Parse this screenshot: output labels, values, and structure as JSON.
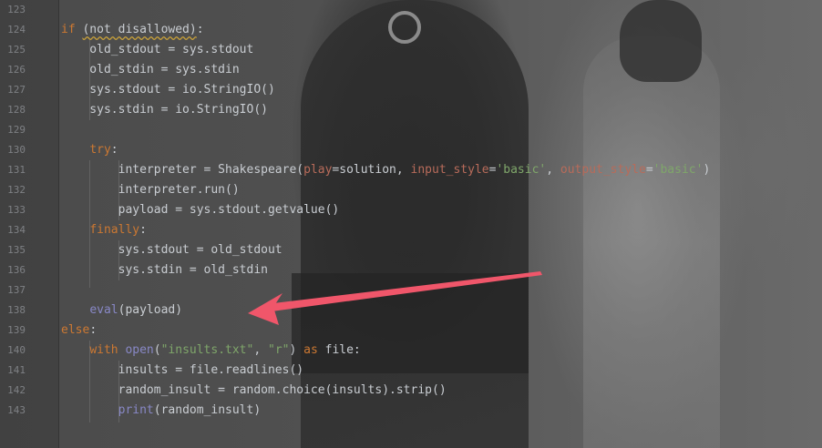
{
  "editor": {
    "lines": [
      {
        "number": "123",
        "tokens": []
      },
      {
        "number": "124",
        "tokens": [
          {
            "t": "if",
            "c": "kw"
          },
          {
            "t": " ",
            "c": "plain"
          },
          {
            "t": "(not disallowed)",
            "c": "plain",
            "squiggle": true
          },
          {
            "t": ":",
            "c": "plain"
          }
        ]
      },
      {
        "number": "125",
        "tokens": [
          {
            "t": "    old_stdout = sys.stdout",
            "c": "plain"
          }
        ]
      },
      {
        "number": "126",
        "tokens": [
          {
            "t": "    old_stdin = sys.stdin",
            "c": "plain"
          }
        ]
      },
      {
        "number": "127",
        "tokens": [
          {
            "t": "    sys.stdout = io.StringIO()",
            "c": "plain"
          }
        ]
      },
      {
        "number": "128",
        "tokens": [
          {
            "t": "    sys.stdin = io.StringIO()",
            "c": "plain"
          }
        ]
      },
      {
        "number": "129",
        "tokens": []
      },
      {
        "number": "130",
        "tokens": [
          {
            "t": "    ",
            "c": "plain"
          },
          {
            "t": "try",
            "c": "kw"
          },
          {
            "t": ":",
            "c": "plain"
          }
        ]
      },
      {
        "number": "131",
        "tokens": [
          {
            "t": "        interpreter = Shakespeare(",
            "c": "plain"
          },
          {
            "t": "play",
            "c": "param"
          },
          {
            "t": "=solution, ",
            "c": "plain"
          },
          {
            "t": "input_style",
            "c": "param"
          },
          {
            "t": "=",
            "c": "plain"
          },
          {
            "t": "'basic'",
            "c": "str"
          },
          {
            "t": ", ",
            "c": "plain"
          },
          {
            "t": "output_style",
            "c": "param"
          },
          {
            "t": "=",
            "c": "plain"
          },
          {
            "t": "'basic'",
            "c": "str"
          },
          {
            "t": ")",
            "c": "plain"
          }
        ]
      },
      {
        "number": "132",
        "tokens": [
          {
            "t": "        interpreter.run()",
            "c": "plain"
          }
        ]
      },
      {
        "number": "133",
        "tokens": [
          {
            "t": "        payload = sys.stdout.getvalue()",
            "c": "plain"
          }
        ]
      },
      {
        "number": "134",
        "tokens": [
          {
            "t": "    ",
            "c": "plain"
          },
          {
            "t": "finally",
            "c": "kw"
          },
          {
            "t": ":",
            "c": "plain"
          }
        ]
      },
      {
        "number": "135",
        "tokens": [
          {
            "t": "        sys.stdout = old_stdout",
            "c": "plain"
          }
        ]
      },
      {
        "number": "136",
        "tokens": [
          {
            "t": "        sys.stdin = old_stdin",
            "c": "plain"
          }
        ]
      },
      {
        "number": "137",
        "tokens": []
      },
      {
        "number": "138",
        "tokens": [
          {
            "t": "    ",
            "c": "plain"
          },
          {
            "t": "eval",
            "c": "bi"
          },
          {
            "t": "(payload)",
            "c": "plain"
          }
        ]
      },
      {
        "number": "139",
        "tokens": [
          {
            "t": "else",
            "c": "kw"
          },
          {
            "t": ":",
            "c": "plain"
          }
        ]
      },
      {
        "number": "140",
        "tokens": [
          {
            "t": "    ",
            "c": "plain"
          },
          {
            "t": "with",
            "c": "kw"
          },
          {
            "t": " ",
            "c": "plain"
          },
          {
            "t": "open",
            "c": "bi"
          },
          {
            "t": "(",
            "c": "plain"
          },
          {
            "t": "\"insults.txt\"",
            "c": "str"
          },
          {
            "t": ", ",
            "c": "plain"
          },
          {
            "t": "\"r\"",
            "c": "str"
          },
          {
            "t": ") ",
            "c": "plain"
          },
          {
            "t": "as",
            "c": "kw"
          },
          {
            "t": " file:",
            "c": "plain"
          }
        ]
      },
      {
        "number": "141",
        "tokens": [
          {
            "t": "        insults = file.readlines()",
            "c": "plain"
          }
        ]
      },
      {
        "number": "142",
        "tokens": [
          {
            "t": "        random_insult = random.choice(insults).strip()",
            "c": "plain"
          }
        ]
      },
      {
        "number": "143",
        "tokens": [
          {
            "t": "        ",
            "c": "plain"
          },
          {
            "t": "print",
            "c": "bi"
          },
          {
            "t": "(random_insult)",
            "c": "plain"
          }
        ]
      }
    ]
  },
  "annotation": {
    "arrow_color": "#f0566a",
    "target": "eval-call-line-138"
  },
  "colors": {
    "keyword": "#cc7832",
    "string": "#7fa66a",
    "param": "#b86b5a",
    "builtin": "#8888c6",
    "text": "#c9cdd2",
    "line_number": "#7e8084"
  }
}
